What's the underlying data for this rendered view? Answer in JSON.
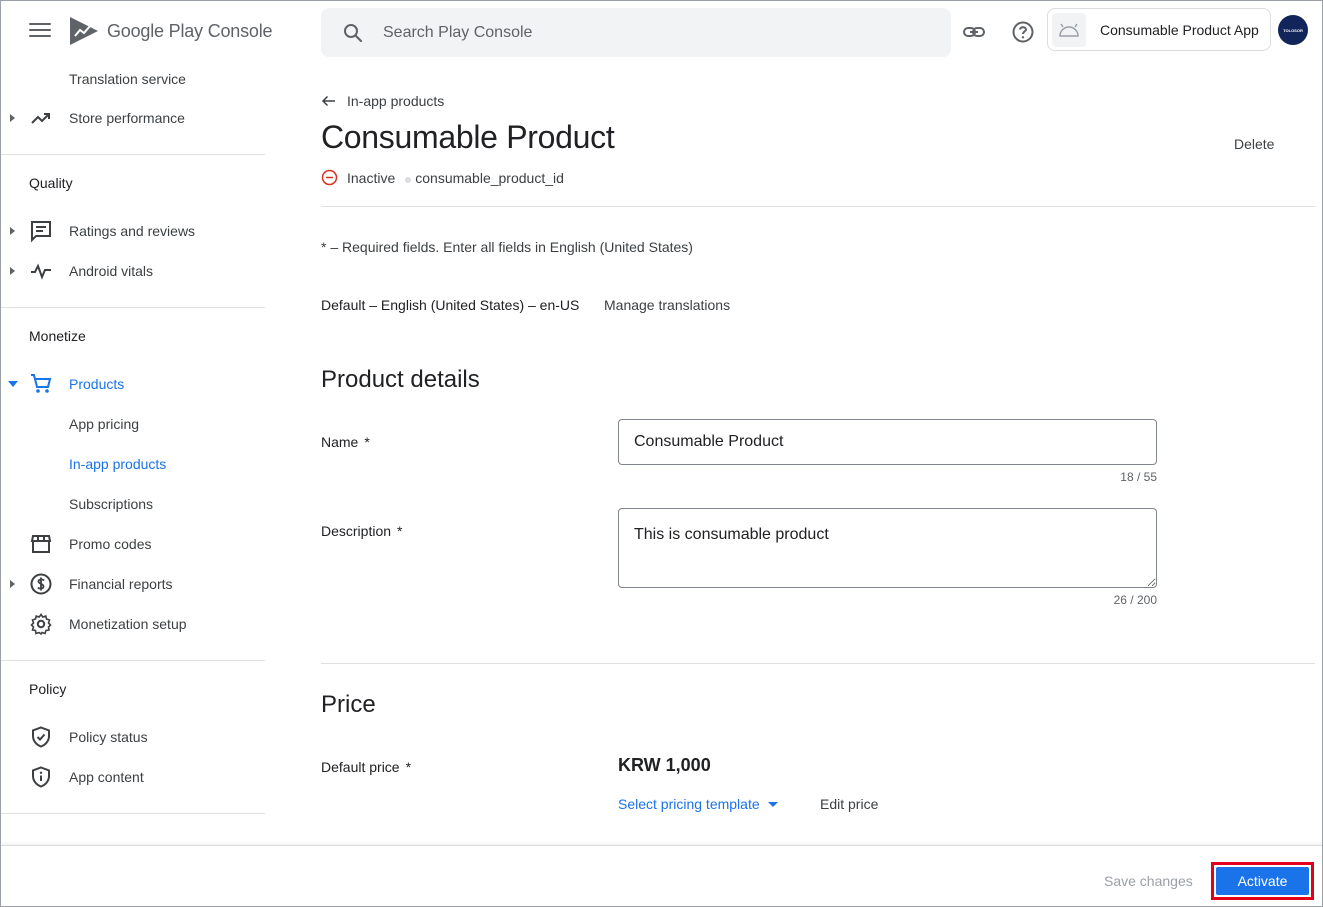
{
  "header": {
    "logo_google": "Google Play",
    "logo_console": "Console",
    "search_placeholder": "Search Play Console",
    "app_name": "Consumable Product App",
    "avatar_text": "TOLOSOR"
  },
  "sidebar": {
    "items": [
      {
        "label": "Translation service",
        "icon": "none"
      },
      {
        "label": "Store performance",
        "icon": "trending-up-icon"
      },
      {
        "label": "Ratings and reviews",
        "icon": "reviews-icon"
      },
      {
        "label": "Android vitals",
        "icon": "vitals-icon"
      },
      {
        "label": "Products",
        "icon": "cart-icon"
      },
      {
        "label": "App pricing",
        "icon": "none"
      },
      {
        "label": "In-app products",
        "icon": "none"
      },
      {
        "label": "Subscriptions",
        "icon": "none"
      },
      {
        "label": "Promo codes",
        "icon": "store-icon"
      },
      {
        "label": "Financial reports",
        "icon": "dollar-icon"
      },
      {
        "label": "Monetization setup",
        "icon": "gear-icon"
      },
      {
        "label": "Policy status",
        "icon": "shield-check-icon"
      },
      {
        "label": "App content",
        "icon": "shield-info-icon"
      }
    ],
    "sections": {
      "quality": "Quality",
      "monetize": "Monetize",
      "policy": "Policy"
    }
  },
  "main": {
    "breadcrumb": "In-app products",
    "title": "Consumable Product",
    "delete_label": "Delete",
    "status": "Inactive",
    "product_id": "consumable_product_id",
    "required_note": "* – Required fields. Enter all fields in English (United States)",
    "default_language": "Default – English (United States) – en-US",
    "manage_translations": "Manage translations",
    "product_details_heading": "Product details",
    "name_label": "Name",
    "name_value": "Consumable Product",
    "name_counter": "18 / 55",
    "description_label": "Description",
    "description_value": "This is consumable product",
    "description_counter": "26 / 200",
    "required_star": "*",
    "price_heading": "Price",
    "default_price_label": "Default price",
    "default_price_value": "KRW 1,000",
    "pricing_template": "Select pricing template",
    "edit_price": "Edit price"
  },
  "footer": {
    "save_changes": "Save changes",
    "activate": "Activate"
  },
  "colors": {
    "accent": "#1a73e8",
    "inactive_status": "#d93025",
    "highlight_outline": "#e2001a"
  }
}
